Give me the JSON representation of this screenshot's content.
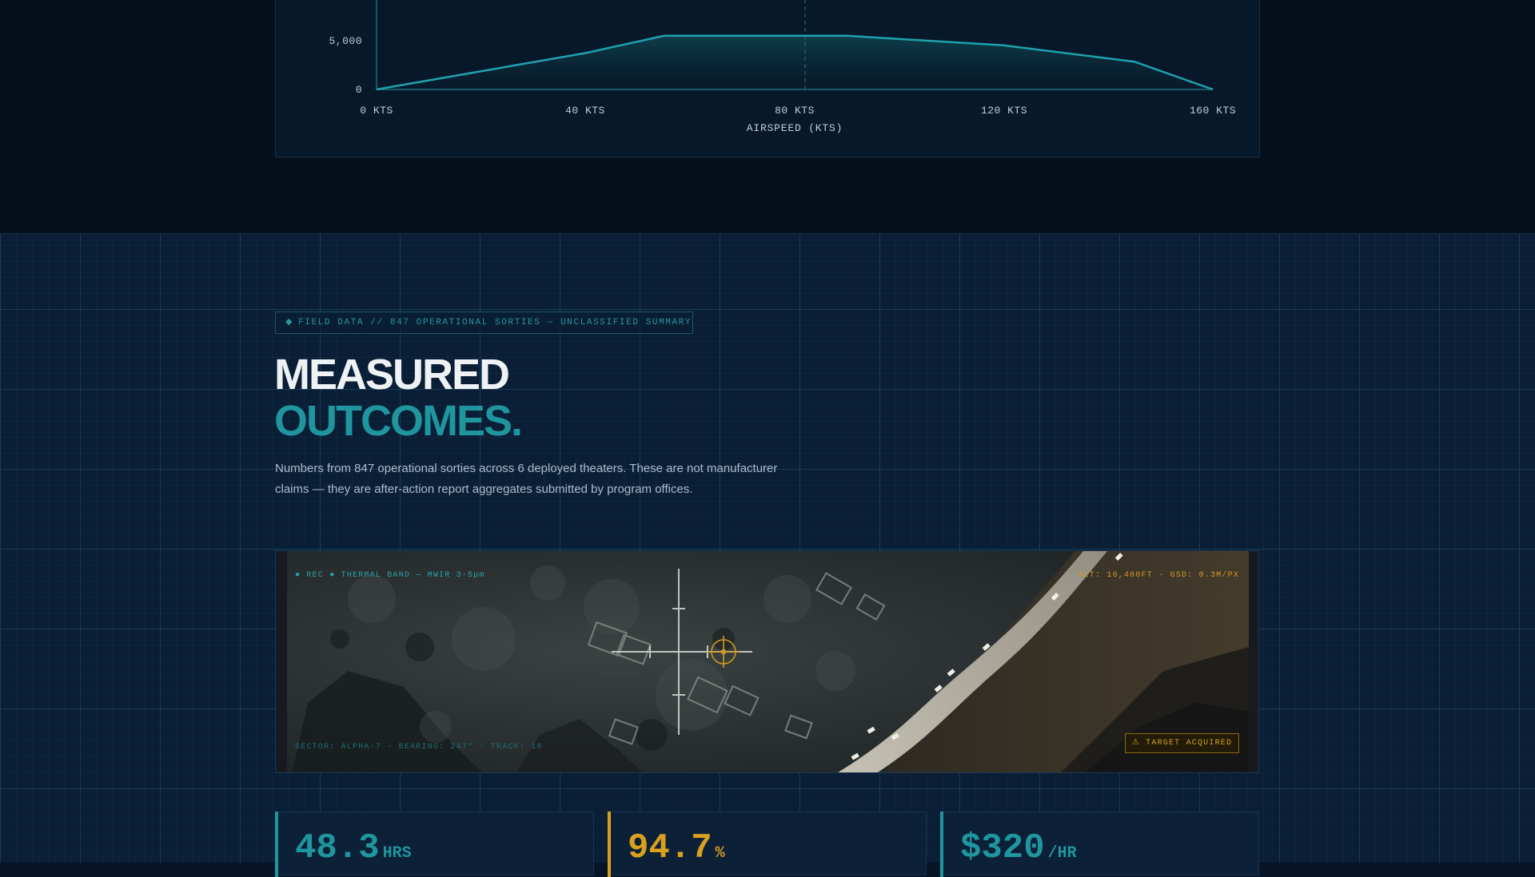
{
  "chart_data": {
    "type": "area",
    "x": [
      0,
      40,
      55,
      90,
      120,
      145,
      160
    ],
    "y": [
      0,
      3800,
      5600,
      5600,
      4600,
      2900,
      0
    ],
    "x_tick_labels": [
      "0 KTS",
      "40 KTS",
      "80 KTS",
      "120 KTS",
      "160 KTS"
    ],
    "y_tick_labels": [
      "0",
      "5,000"
    ],
    "xlabel": "AIRSPEED (KTS)",
    "xlim": [
      0,
      160
    ],
    "ylim": [
      0,
      8000
    ],
    "marker_x": 82,
    "colors": {
      "line": "#1fa2ad"
    }
  },
  "section": {
    "tag_text": "FIELD DATA // 847 OPERATIONAL SORTIES — UNCLASSIFIED SUMMARY",
    "headline_line1": "MEASURED",
    "headline_line2": "OUTCOMES.",
    "description": "Numbers from 847 operational sorties across 6 deployed theaters. These are not manufacturer claims — they are after-action report aggregates submitted by program offices."
  },
  "imagery": {
    "rec_label": "REC ● THERMAL BAND — MWIR 3-5μm",
    "alt_label": "ALT: 16,400FT · GSD: 0.3M/PX",
    "sector_label": "SECTOR: ALPHA-7 · BEARING: 247° · TRACK: 18",
    "target_label": "⚠ TARGET ACQUIRED"
  },
  "stats": [
    {
      "value": "48.3",
      "unit": "HRS",
      "color": "#1f959d"
    },
    {
      "value": "94.7",
      "unit": "%",
      "color": "#d9a01e"
    },
    {
      "value": "$320",
      "unit": "/HR",
      "color": "#1f959d"
    }
  ],
  "colors": {
    "accent_teal": "#1f959d",
    "accent_amber": "#d9a01e"
  }
}
